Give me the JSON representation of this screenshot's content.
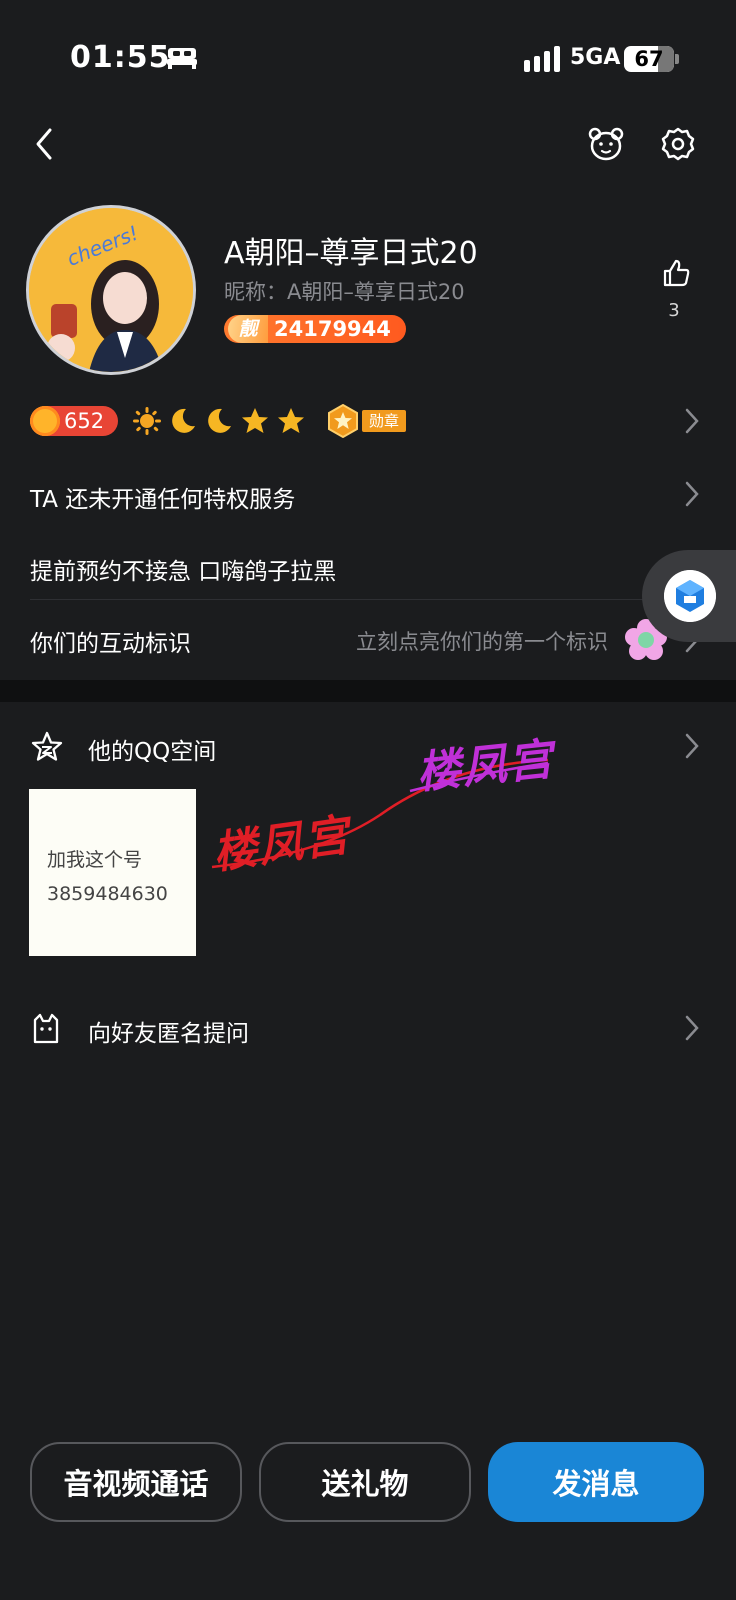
{
  "status_bar": {
    "time": "01:55",
    "network": "5GA",
    "battery": "67",
    "battery_level": 0.67
  },
  "nav": {
    "back_icon": "chevron-left-icon",
    "bear_icon": "bear-face-icon",
    "settings_icon": "gear-icon"
  },
  "profile": {
    "name": "A朝阳–尊享日式20",
    "nickname": "昵称：A朝阳–尊享日式20",
    "id_prefix": "靓",
    "id_number": "24179944",
    "likes": "3",
    "avatar_caption": "cheers!"
  },
  "levels": {
    "level_value": "652",
    "icons": [
      "sun-icon",
      "moon-icon",
      "moon-icon",
      "star-icon",
      "star-icon"
    ],
    "medal_label": "勋章"
  },
  "rows": {
    "privilege": "TA 还未开通任何特权服务",
    "reserve": "提前预约不接急 口嗨鸽子拉黑",
    "interaction": "你们的互动标识",
    "interaction_hint": "立刻点亮你们的第一个标识"
  },
  "qzone": {
    "label": "他的QQ空间",
    "note_line1": "加我这个号",
    "note_line2": "3859484630"
  },
  "watermark": {
    "text_red": "楼凤宫",
    "text_purple": "楼凤宫"
  },
  "ask": {
    "label": "向好友匿名提问"
  },
  "bottom_buttons": {
    "call": "音视频通话",
    "gift": "送礼物",
    "message": "发消息"
  },
  "colors": {
    "background": "#1b1c1e",
    "accent_blue": "#1a86d6",
    "id_badge": "#ff6a26",
    "level_badge": "#e84535"
  }
}
